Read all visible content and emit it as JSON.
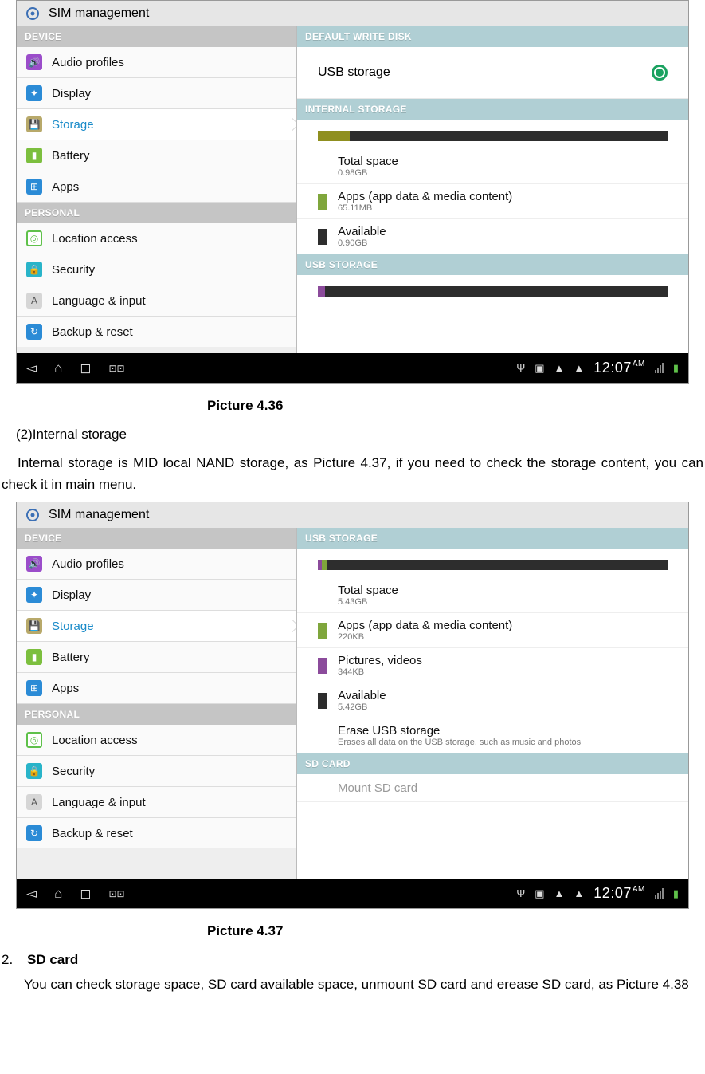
{
  "figures": {
    "a": {
      "titlebar": "SIM management",
      "left_headers": [
        "DEVICE",
        "PERSONAL"
      ],
      "device_items": [
        {
          "label": "Audio profiles",
          "color": "#9b4dca",
          "glyph": "🔊"
        },
        {
          "label": "Display",
          "color": "#2b8bd6",
          "glyph": "✦"
        },
        {
          "label": "Storage",
          "color": "#9aa24a",
          "glyph": "💾",
          "selected": true
        },
        {
          "label": "Battery",
          "color": "#7cbf3e",
          "glyph": "▮"
        },
        {
          "label": "Apps",
          "color": "#2b8bd6",
          "glyph": "⊞"
        }
      ],
      "personal_items": [
        {
          "label": "Location access",
          "color": "#5fc14a",
          "glyph": "◎"
        },
        {
          "label": "Security",
          "color": "#29b4c9",
          "glyph": "🔒"
        },
        {
          "label": "Language & input",
          "color": "#9a9a9a",
          "glyph": "A"
        },
        {
          "label": "Backup & reset",
          "color": "#2b8bd6",
          "glyph": "↻"
        }
      ],
      "right": {
        "section1": "DEFAULT WRITE DISK",
        "usb_option": "USB storage",
        "section2": "INTERNAL STORAGE",
        "bar_segments": [
          {
            "class": "olive",
            "width": "9%"
          },
          {
            "class": "dk",
            "width": "91%"
          }
        ],
        "stats": [
          {
            "title": "Total space",
            "sub": "0.98GB",
            "chip": ""
          },
          {
            "title": "Apps (app data & media content)",
            "sub": "65.11MB",
            "chip": "green"
          },
          {
            "title": "Available",
            "sub": "0.90GB",
            "chip": ""
          }
        ],
        "section3": "USB STORAGE",
        "bar2_segments": [
          {
            "class": "purple",
            "width": "2%"
          },
          {
            "class": "dk",
            "width": "98%"
          }
        ]
      },
      "caption": "Picture 4.36"
    },
    "b": {
      "titlebar": "SIM management",
      "right": {
        "section1": "USB STORAGE",
        "bar_segments": [
          {
            "class": "purple",
            "width": "1.2%"
          },
          {
            "class": "green",
            "width": "1.5%"
          },
          {
            "class": "dk",
            "width": "97.3%"
          }
        ],
        "stats": [
          {
            "title": "Total space",
            "sub": "5.43GB",
            "chip": ""
          },
          {
            "title": "Apps (app data & media content)",
            "sub": "220KB",
            "chip": "green"
          },
          {
            "title": "Pictures, videos",
            "sub": "344KB",
            "chip": "purple"
          },
          {
            "title": "Available",
            "sub": "5.42GB",
            "chip": ""
          },
          {
            "title": "Erase USB storage",
            "sub": "Erases all data on the USB storage, such as music and photos",
            "chip": "none"
          }
        ],
        "section2": "SD CARD",
        "mount": "Mount SD card"
      },
      "caption": "Picture 4.37"
    }
  },
  "text": {
    "heading1": "(2)Internal storage",
    "para1": "Internal storage is MID local NAND storage, as Picture 4.37, if you need to check the storage content, you can check it in main menu.",
    "list_num": "2.",
    "list_label": "SD card",
    "para2": "You can check storage space, SD card available space, unmount SD card and erease SD card, as Picture 4.38"
  },
  "statusbar": {
    "time": "12:07",
    "ampm": "AM"
  }
}
